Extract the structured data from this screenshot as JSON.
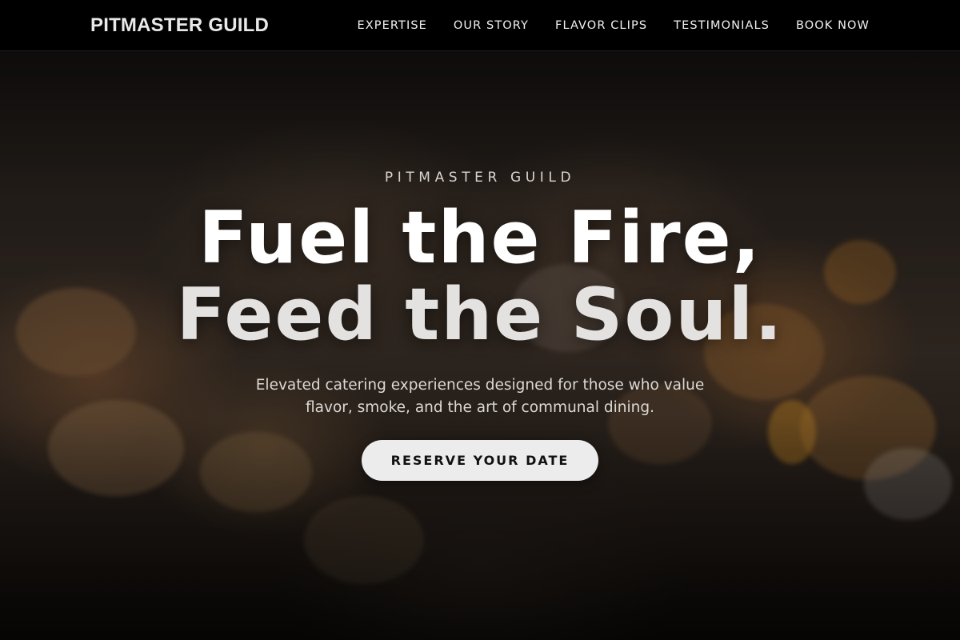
{
  "nav": {
    "brand": "PITMASTER GUILD",
    "links": [
      {
        "label": "EXPERTISE"
      },
      {
        "label": "OUR STORY"
      },
      {
        "label": "FLAVOR CLIPS"
      },
      {
        "label": "TESTIMONIALS"
      },
      {
        "label": "BOOK NOW"
      }
    ]
  },
  "hero": {
    "eyebrow": "PITMASTER GUILD",
    "headline_line1": "Fuel the Fire,",
    "headline_line2": "Feed the Soul.",
    "subtitle": "Elevated catering experiences designed for those who value flavor, smoke, and the art of communal dining.",
    "cta_label": "RESERVE YOUR DATE",
    "background_image": "blurred catering appetizer spread (food-background-photo)"
  },
  "colors": {
    "nav_background": "#000000",
    "cta_background": "#ececec",
    "cta_text": "#111111",
    "headline": "#ffffff"
  }
}
